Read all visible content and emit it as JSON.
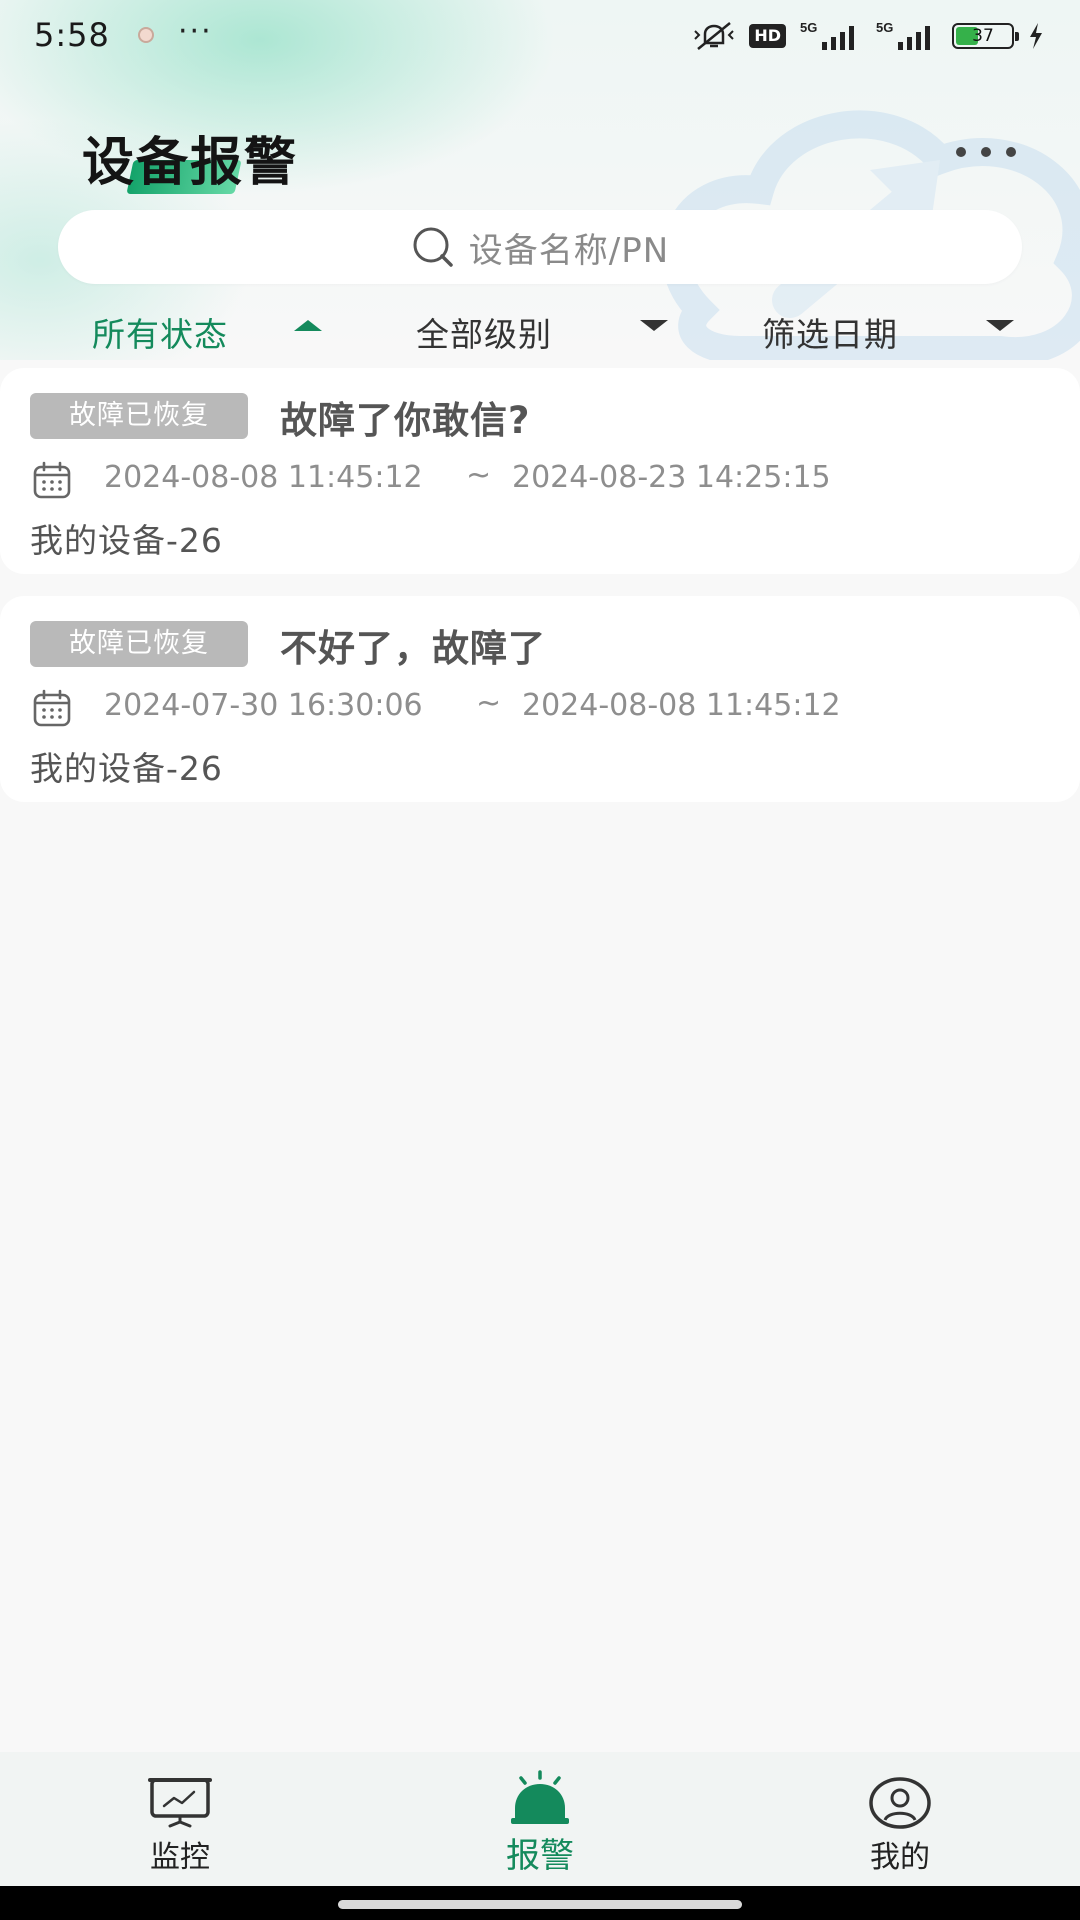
{
  "status_bar": {
    "time": "5:58",
    "more": "···",
    "network_1": "5G",
    "network_2": "5G",
    "hd": "HD",
    "battery": "37"
  },
  "header": {
    "title": "设备报警",
    "more_icon": "more-horizontal-icon"
  },
  "search": {
    "placeholder": "设备名称/PN",
    "icon": "search-icon"
  },
  "filters": [
    {
      "label": "所有状态",
      "state": "expanded",
      "active": true
    },
    {
      "label": "全部级别",
      "state": "collapsed",
      "active": false
    },
    {
      "label": "筛选日期",
      "state": "collapsed",
      "active": false
    }
  ],
  "alarms": [
    {
      "status": "故障已恢复",
      "title": "故障了你敢信?",
      "start": "2024-08-08 11:45:12",
      "separator": "~",
      "end": "2024-08-23 14:25:15",
      "device": "我的设备-26"
    },
    {
      "status": "故障已恢复",
      "title": "不好了，故障了",
      "start": "2024-07-30 16:30:06",
      "separator": "~",
      "end": "2024-08-08 11:45:12",
      "device": "我的设备-26"
    }
  ],
  "bottom_nav": [
    {
      "label": "监控",
      "icon": "monitor-icon",
      "active": false
    },
    {
      "label": "报警",
      "icon": "alarm-siren-icon",
      "active": true
    },
    {
      "label": "我的",
      "icon": "user-profile-icon",
      "active": false
    }
  ],
  "colors": {
    "accent": "#148a5c",
    "badge": "#b9b9b9",
    "background": "#f8f8f8"
  }
}
